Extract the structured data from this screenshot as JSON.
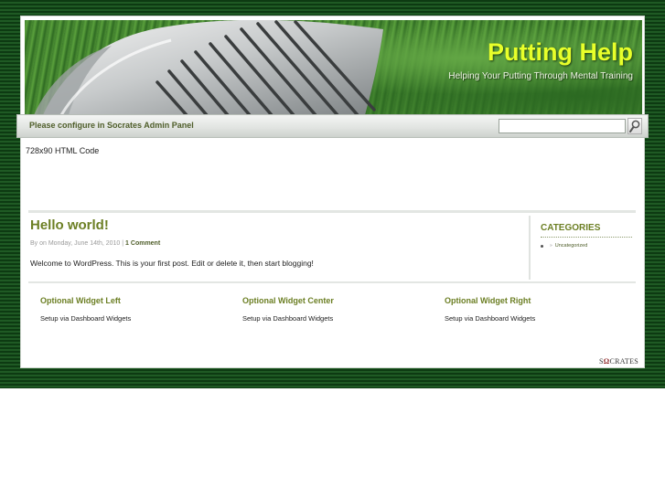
{
  "header": {
    "site_title": "Putting Help",
    "site_description": "Helping Your Putting Through Mental Training"
  },
  "navbar": {
    "notice": "Please configure in Socrates Admin Panel",
    "search_value": "",
    "search_placeholder": ""
  },
  "ad": {
    "text": "728x90 HTML Code"
  },
  "post": {
    "title": "Hello world!",
    "meta_prefix": "By  on Monday, June 14th, 2010 | ",
    "comment_link": "1 Comment",
    "body": "Welcome to WordPress. This is your first post. Edit or delete it, then start blogging!"
  },
  "sidebar": {
    "categories_title": "CATEGORIES",
    "categories": [
      {
        "label": "Uncategorized"
      }
    ]
  },
  "widgets": [
    {
      "title": "Optional Widget Left",
      "text": "Setup via Dashboard Widgets"
    },
    {
      "title": "Optional Widget Center",
      "text": "Setup via Dashboard Widgets"
    },
    {
      "title": "Optional Widget Right",
      "text": "Setup via Dashboard Widgets"
    }
  ],
  "footer": {
    "credit_pre": "S",
    "credit_omega": "Ω",
    "credit_post": "CRATES"
  },
  "colors": {
    "title_yellow": "#e8ff2a",
    "accent_green": "#6c7f24",
    "page_dark_green": "#0d3a12"
  },
  "icons": {
    "search_button": "magnifier-icon",
    "category_bullet": "arrow-icon"
  }
}
